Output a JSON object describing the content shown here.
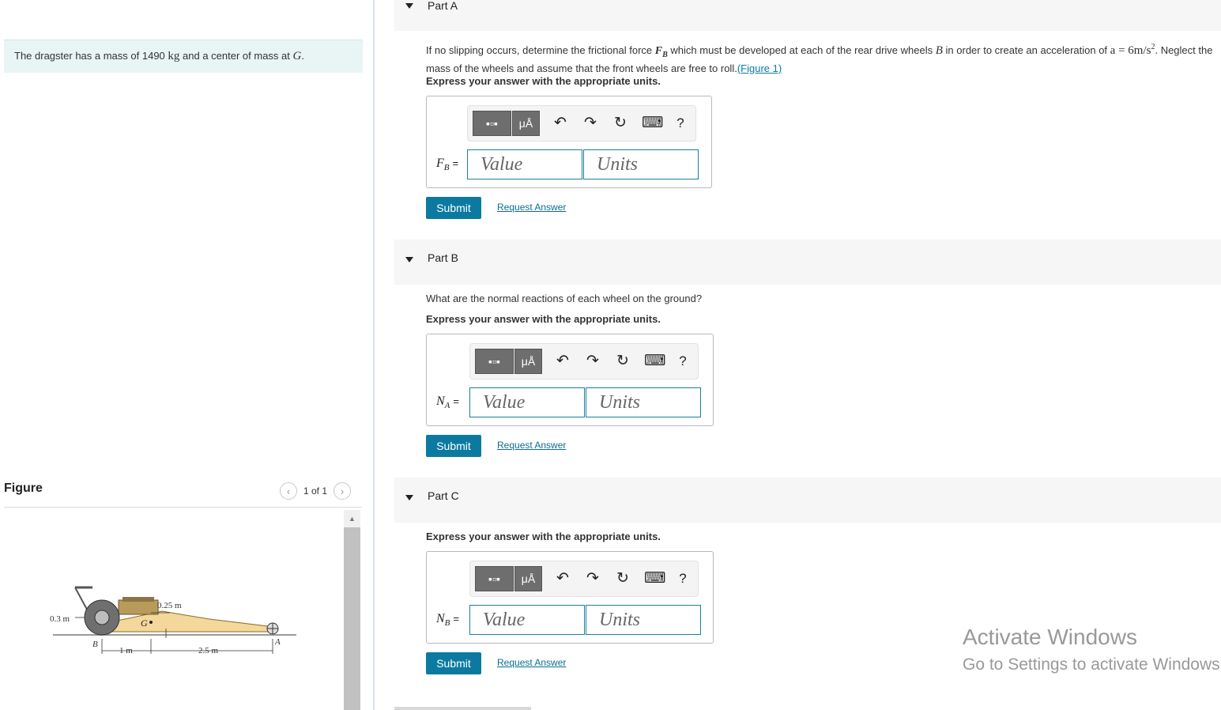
{
  "intro": {
    "pre": "The dragster has a mass of 1490",
    "unit": "kg",
    "mid": "and a center of mass at",
    "point": "G",
    "end": "."
  },
  "figure": {
    "title": "Figure",
    "counter": "1 of 1",
    "labels": {
      "height_b": "0.3 m",
      "height_g": "0.25 m",
      "dist_bg": "1 m",
      "dist_ga": "2.5 m",
      "point_b": "B",
      "point_a": "A",
      "point_g": "G"
    }
  },
  "toolbar": {
    "units_label": "μÅ",
    "undo": "↶",
    "redo": "↷",
    "reset": "↻",
    "keyboard": "⌨",
    "help": "?"
  },
  "parts": [
    {
      "label": "Part A",
      "question_pre": "If no slipping occurs, determine the frictional force",
      "force_sym": "F",
      "force_sub": "B",
      "question_mid": "which must be developed at each of the rear drive wheels",
      "wheel": "B",
      "question_mid2": "in order to create an acceleration of",
      "accel": "a = 6m/s",
      "accel_exp": "2",
      "question_end": ". Neglect the mass of the wheels and assume that the front wheels are free to roll.",
      "figure_link": "(Figure 1)",
      "instruction": "Express your answer with the appropriate units.",
      "var": "F",
      "var_sub": "B",
      "value_placeholder": "Value",
      "units_placeholder": "Units",
      "submit": "Submit",
      "request": "Request Answer"
    },
    {
      "label": "Part B",
      "question": "What are the normal reactions of each wheel on the ground?",
      "instruction": "Express your answer with the appropriate units.",
      "var": "N",
      "var_sub": "A",
      "value_placeholder": "Value",
      "units_placeholder": "Units",
      "submit": "Submit",
      "request": "Request Answer"
    },
    {
      "label": "Part C",
      "instruction": "Express your answer with the appropriate units.",
      "var": "N",
      "var_sub": "B",
      "value_placeholder": "Value",
      "units_placeholder": "Units",
      "submit": "Submit",
      "request": "Request Answer"
    }
  ],
  "watermark": {
    "line1": "Activate Windows",
    "line2": "Go to Settings to activate Windows."
  }
}
